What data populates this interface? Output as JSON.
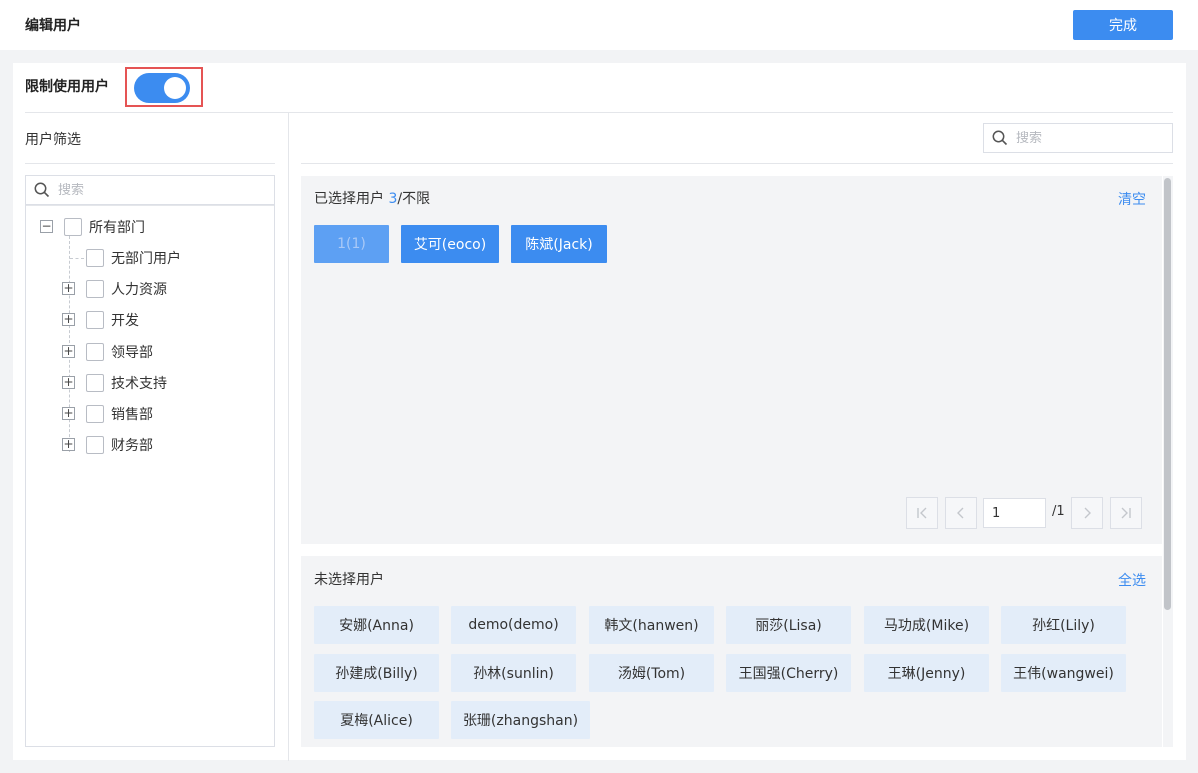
{
  "header": {
    "title": "编辑用户",
    "done_label": "完成"
  },
  "limit": {
    "label": "限制使用用户",
    "enabled": true
  },
  "filter": {
    "title": "用户筛选",
    "search_placeholder": "搜索",
    "tree": {
      "root": "所有部门",
      "children": [
        "无部门用户",
        "人力资源",
        "开发",
        "领导部",
        "技术支持",
        "销售部",
        "财务部"
      ]
    }
  },
  "right_search": {
    "placeholder": "搜索"
  },
  "selected": {
    "label": "已选择用户",
    "count": "3",
    "limit": "/不限",
    "clear_label": "清空",
    "chips": [
      "1(1)",
      "艾可(eoco)",
      "陈斌(Jack)"
    ]
  },
  "pagination": {
    "current": "1",
    "total": "/1"
  },
  "unselected": {
    "label": "未选择用户",
    "select_all_label": "全选",
    "chips": [
      "安娜(Anna)",
      "demo(demo)",
      "韩文(hanwen)",
      "丽莎(Lisa)",
      "马功成(Mike)",
      "孙红(Lily)",
      "孙建成(Billy)",
      "孙林(sunlin)",
      "汤姆(Tom)",
      "王国强(Cherry)",
      "王琳(Jenny)",
      "王伟(wangwei)",
      "夏梅(Alice)",
      "张珊(zhangshan)"
    ]
  },
  "colors": {
    "primary": "#3c8cf0",
    "highlight_border": "#e55454",
    "chip_bg": "#e3edf9"
  }
}
